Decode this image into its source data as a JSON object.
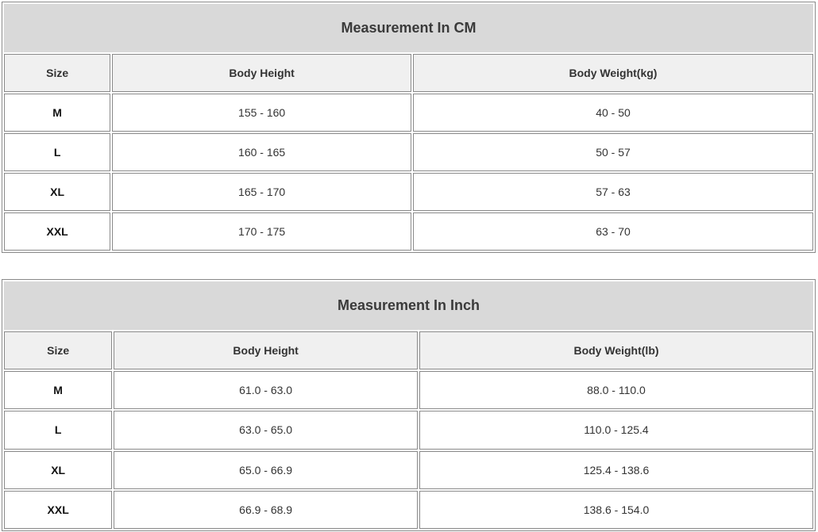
{
  "tables": [
    {
      "title": "Measurement In CM",
      "headers": [
        "Size",
        "Body Height",
        "Body Weight(kg)"
      ],
      "rows": [
        [
          "M",
          "155 - 160",
          "40 - 50"
        ],
        [
          "L",
          "160 - 165",
          "50 - 57"
        ],
        [
          "XL",
          "165 - 170",
          "57 - 63"
        ],
        [
          "XXL",
          "170 - 175",
          "63 - 70"
        ]
      ]
    },
    {
      "title": "Measurement In Inch",
      "headers": [
        "Size",
        "Body Height",
        "Body Weight(lb)"
      ],
      "rows": [
        [
          "M",
          "61.0 - 63.0",
          "88.0 - 110.0"
        ],
        [
          "L",
          "63.0 - 65.0",
          "110.0 - 125.4"
        ],
        [
          "XL",
          "65.0 - 66.9",
          "125.4 - 138.6"
        ],
        [
          "XXL",
          "66.9 - 68.9",
          "138.6 - 154.0"
        ]
      ]
    }
  ]
}
